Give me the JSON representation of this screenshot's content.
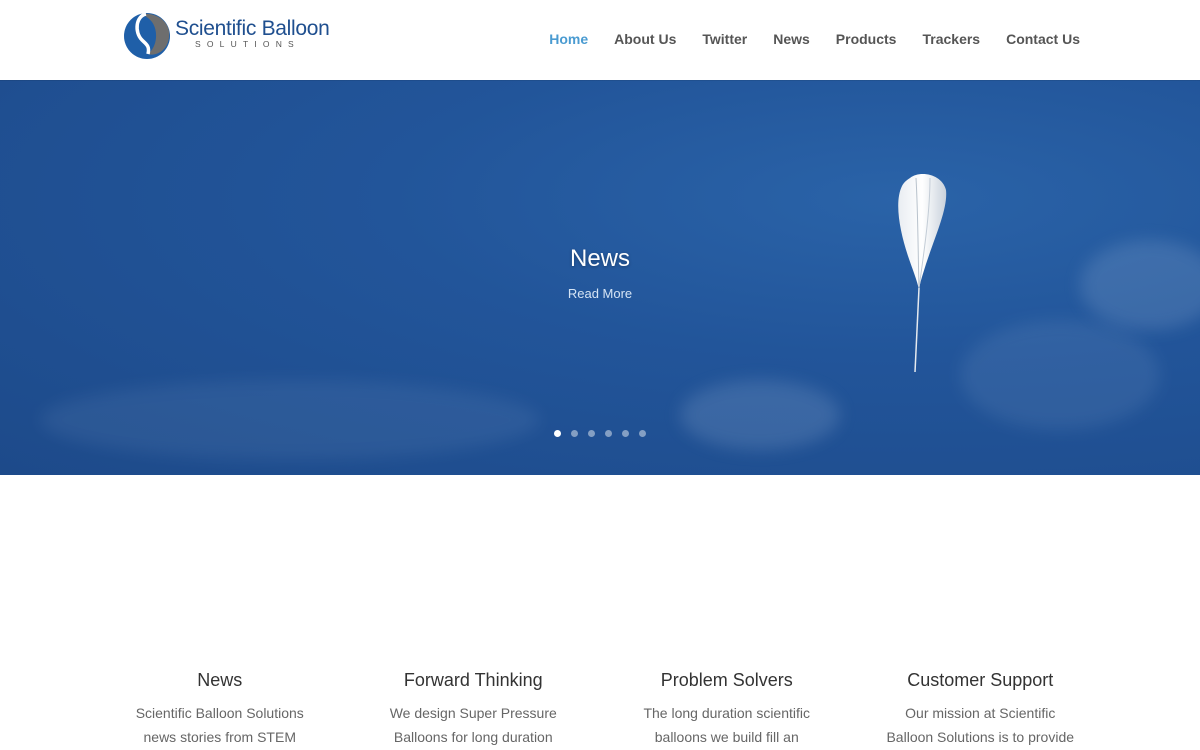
{
  "logo": {
    "name": "Scientific Balloon",
    "sub": "SOLUTIONS"
  },
  "nav": {
    "items": [
      {
        "label": "Home"
      },
      {
        "label": "About Us"
      },
      {
        "label": "Twitter"
      },
      {
        "label": "News"
      },
      {
        "label": "Products"
      },
      {
        "label": "Trackers"
      },
      {
        "label": "Contact Us"
      }
    ],
    "active_index": 0
  },
  "hero": {
    "title": "News",
    "link_label": "Read More",
    "slide_count": 6,
    "active_slide": 0
  },
  "features": [
    {
      "title": "News",
      "text": "Scientific Balloon Solutions news stories from STEM"
    },
    {
      "title": "Forward Thinking",
      "text": "We design Super Pressure Balloons for long duration"
    },
    {
      "title": "Problem Solvers",
      "text": "The long duration scientific balloons we build fill an"
    },
    {
      "title": "Customer Support",
      "text": "Our mission at Scientific Balloon Solutions is to provide"
    }
  ],
  "colors": {
    "accent": "#4a9bd1",
    "brand_blue": "#1f4f8f",
    "hero_bg": "#22559a"
  }
}
